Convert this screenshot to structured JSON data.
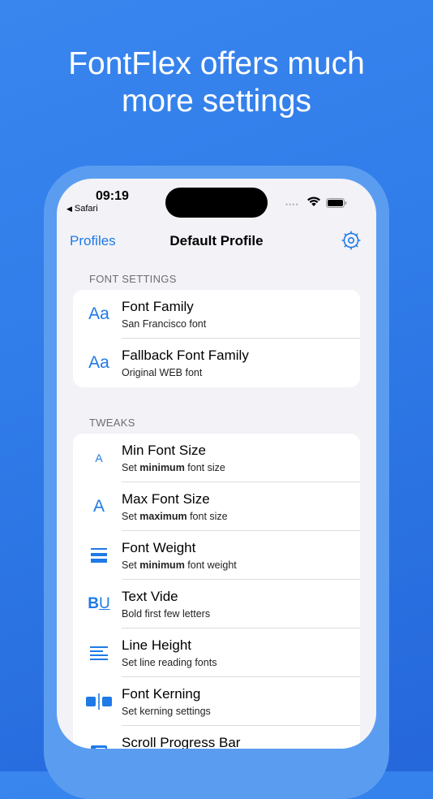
{
  "headline": {
    "line1": "FontFlex offers much",
    "line2": "more settings"
  },
  "status_bar": {
    "time": "09:19",
    "back_app": "Safari"
  },
  "nav": {
    "left": "Profiles",
    "title": "Default Profile"
  },
  "sections": {
    "font_settings": {
      "header": "FONT SETTINGS",
      "rows": [
        {
          "icon_text": "Aa",
          "title": "Font Family",
          "subtitle": "San Francisco font"
        },
        {
          "icon_text": "Aa",
          "title": "Fallback Font Family",
          "subtitle": "Original WEB font"
        }
      ]
    },
    "tweaks": {
      "header": "TWEAKS",
      "rows": [
        {
          "icon_text": "A",
          "title": "Min Font Size",
          "sub_pre": "Set ",
          "sub_bold": "minimum",
          "sub_post": " font size"
        },
        {
          "icon_text": "A",
          "title": "Max Font Size",
          "sub_pre": "Set ",
          "sub_bold": "maximum",
          "sub_post": " font size"
        },
        {
          "icon": "bars-icon",
          "title": "Font Weight",
          "sub_pre": "Set ",
          "sub_bold": "minimum",
          "sub_post": " font weight"
        },
        {
          "icon_b": "B",
          "icon_u": "U",
          "title": "Text Vide",
          "subtitle": "Bold first few letters"
        },
        {
          "icon": "lines-icon",
          "title": "Line Height",
          "subtitle": "Set line reading fonts"
        },
        {
          "icon": "kerning-icon",
          "title": "Font Kerning",
          "subtitle": "Set kerning settings"
        },
        {
          "icon": "progress-bar-icon",
          "title": "Scroll Progress Bar",
          "subtitle": ""
        }
      ]
    }
  },
  "colors": {
    "accent": "#1f7ae6",
    "background": "#2f7be8",
    "list_bg": "#f2f2f7"
  }
}
